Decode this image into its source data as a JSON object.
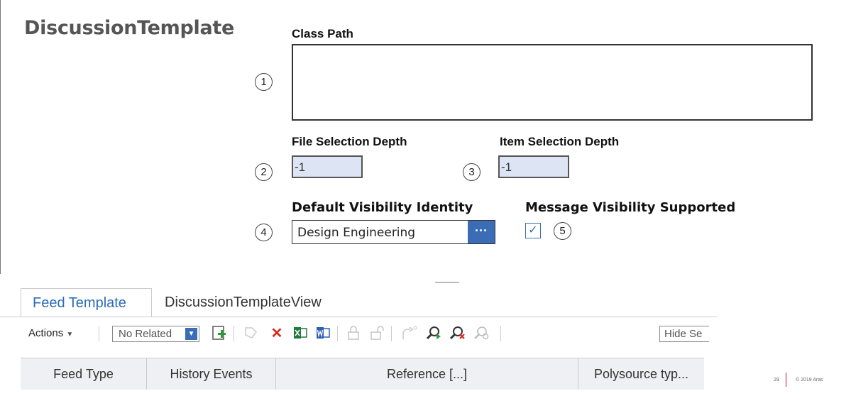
{
  "form": {
    "title": "DiscussionTemplate",
    "class_path_label": "Class Path",
    "class_path_value": "",
    "file_depth_label": "File Selection Depth",
    "file_depth_value": "-1",
    "item_depth_label": "Item Selection Depth",
    "item_depth_value": "-1",
    "visibility_label": "Default Visibility Identity",
    "visibility_value": "Design Engineering",
    "visibility_button": "···",
    "message_visibility_label": "Message Visibility Supported",
    "message_visibility_checked": true,
    "callouts": [
      "1",
      "2",
      "3",
      "4",
      "5"
    ]
  },
  "tabs": [
    {
      "label": "Feed Template",
      "active": true
    },
    {
      "label": "DiscussionTemplateView",
      "active": false
    }
  ],
  "toolbar": {
    "actions_label": "Actions",
    "related_select": "No Related",
    "hide_box": "Hide Se",
    "icons": [
      "new-item-icon",
      "pick-icon",
      "delete-icon",
      "excel-export-icon",
      "word-export-icon",
      "lock-icon",
      "unlock-icon",
      "promote-icon",
      "search-icon",
      "clear-search-icon",
      "saved-search-icon"
    ]
  },
  "grid": {
    "columns": [
      "Feed Type",
      "History Events",
      "Reference [...]",
      "Polysource typ..."
    ]
  },
  "footer": {
    "page": "29",
    "copyright": "© 2019 Aras"
  },
  "colors": {
    "accent": "#3a6db5",
    "field_bg": "#dde5f4",
    "footer_bar": "#c8102e"
  }
}
